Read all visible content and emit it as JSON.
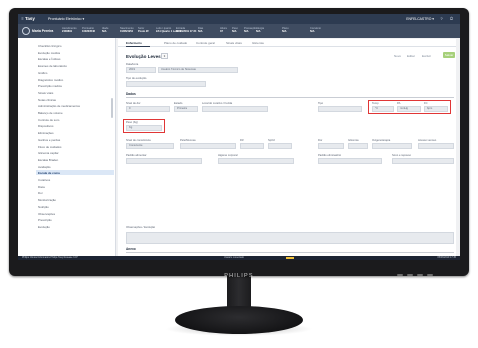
{
  "monitor": {
    "brand": "PHILIPS"
  },
  "app": {
    "title": "Tasy",
    "module": "Prontuário Eletrônico ▾",
    "user": "ENFELCASTRO ▾"
  },
  "patient": {
    "name": "Maria Pereira",
    "fields": [
      {
        "key": "Atendimento",
        "value": "2436891"
      },
      {
        "key": "Prontuário",
        "value": "100203546"
      },
      {
        "key": "Idade",
        "value": "N/A"
      },
      {
        "key": "Nascimento",
        "value": "01/06/1954"
      },
      {
        "key": "Setor",
        "value": "Posto 2F"
      },
      {
        "key": "Leito / quarto",
        "value": "2A1 Quarto 1 Leito 2"
      },
      {
        "key": "Entrada",
        "value": "05/03/2019 17:34"
      },
      {
        "key": "Dias",
        "value": "N/A"
      },
      {
        "key": "Altura",
        "value": "37"
      },
      {
        "key": "Peso",
        "value": "N/A"
      },
      {
        "key": "Precaução",
        "value": "N/A"
      },
      {
        "key": "Alergia",
        "value": "N/A"
      },
      {
        "key": "Plano",
        "value": "N/A"
      },
      {
        "key": "Convênio",
        "value": "N/A"
      }
    ]
  },
  "sidebar": {
    "items": [
      "Checklist cirúrgico",
      "Evolução médica",
      "Escalas e Índices",
      "Exames de laboratório",
      "Gráfico",
      "Diagnóstico médico",
      "Prescrição médica",
      "Sinais vitais",
      "Notas clínicas",
      "Administração de medicamentos",
      "Balanço de volume",
      "Controle de soro",
      "Dispositivos",
      "Eliminações",
      "Ganhos e perdas",
      "Fluxo de cuidados",
      "Glicemia capilar",
      "Escalas Braden",
      "Avaliação",
      "Escala de coma",
      "Curativos",
      "Dieta",
      "Dor",
      "Monitorização",
      "Nutrição",
      "Observações",
      "Prescrição",
      "Evolução"
    ],
    "active_index": 19
  },
  "tabs": [
    "Enfermeiro",
    "Plano de cuidado",
    "Controle geral",
    "Sinais vitais",
    "Glicemia"
  ],
  "main": {
    "title": "Evolução Leves",
    "count": "3",
    "actions": [
      "Novo",
      "Editar",
      "Excluir"
    ],
    "save": "Salvar",
    "fields": {
      "data_label": "Data/Hora",
      "data_value": "2019",
      "profissional_value": "Usuário Técnico de Sistemas",
      "tipo_label": "Tipo de evolução",
      "sec_dados": "Dados",
      "f1_label": "Nível de dor",
      "f1_value": "0",
      "f2_label": "Estado",
      "f2_value": "Primeira",
      "f3_label": "Local do curativo / Ferida",
      "f4_label": "Tipo",
      "f5_label": "Temp",
      "f5_value": "°C",
      "f6_label": "PA",
      "f6_value": "mmHg",
      "f7_label": "FC",
      "f7_value": "bpm",
      "peso_label": "Peso (Kg)",
      "peso_value": "Kg",
      "l1": "Nível de consciência",
      "l1_value": "Consciente",
      "l2": "Pele/Mucosa",
      "l3": "FR",
      "l4": "SpO2",
      "l5": "Dor",
      "l6": "Glicemia",
      "l7": "Oxigenoterapia",
      "l8": "Acesso venoso",
      "l9": "Padrão alimentar",
      "l10": "Higiene corporal",
      "l11": "Padrão eliminatório",
      "l12": "Sono e repouso",
      "obs": "Observações / Evolução",
      "sec_anexo": "Anexo"
    }
  },
  "status": {
    "left": "Philips Clinical Informatics  Philips Tasy  Release 3.07",
    "mid": "Usuário conectado",
    "right": "05/03/2019  17:45"
  },
  "colors": {
    "header": "#2d3b51",
    "highlight": "#e03636",
    "save_button": "#a6d07a"
  }
}
